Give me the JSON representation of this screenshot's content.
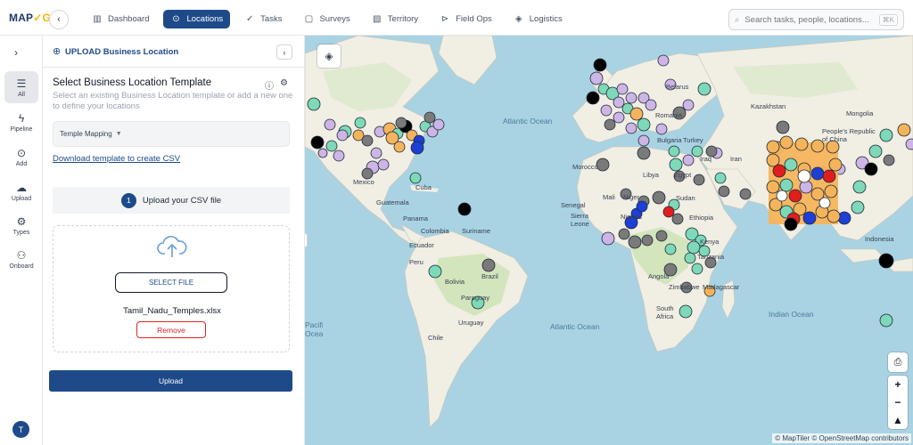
{
  "app": {
    "logo_main": "MAP",
    "logo_accent": "✓G"
  },
  "nav": [
    {
      "label": "Dashboard",
      "icon": "bar-chart-icon",
      "glyph": "▥",
      "active": false
    },
    {
      "label": "Locations",
      "icon": "map-pin-icon",
      "glyph": "⊙",
      "active": true
    },
    {
      "label": "Tasks",
      "icon": "check-list-icon",
      "glyph": "✓",
      "active": false
    },
    {
      "label": "Surveys",
      "icon": "clipboard-icon",
      "glyph": "▢",
      "active": false
    },
    {
      "label": "Territory",
      "icon": "map-icon",
      "glyph": "▧",
      "active": false
    },
    {
      "label": "Field Ops",
      "icon": "signal-icon",
      "glyph": "⊳",
      "active": false
    },
    {
      "label": "Logistics",
      "icon": "box-icon",
      "glyph": "◈",
      "active": false
    }
  ],
  "search": {
    "placeholder": "Search tasks, people, locations...",
    "shortcut": "⌘K"
  },
  "rail": [
    {
      "label": "All",
      "glyph": "☰",
      "active": true
    },
    {
      "label": "Pipeline",
      "glyph": "ϟ",
      "active": false
    },
    {
      "label": "Add",
      "glyph": "⊙",
      "active": false
    },
    {
      "label": "Upload",
      "glyph": "☁",
      "active": false
    },
    {
      "label": "Types",
      "glyph": "⚙",
      "active": false
    },
    {
      "label": "Onboard",
      "glyph": "⚇",
      "active": false
    }
  ],
  "user": {
    "initial": "T"
  },
  "panel": {
    "header_title": "UPLOAD Business Location",
    "template_title": "Select Business Location Template",
    "template_desc": "Select an existing Business Location template or add a new one to define your locations",
    "selected_template": "Temple Mapping",
    "download_link": "Download template to create CSV",
    "step_number": "1",
    "step_label": "Upload your CSV file",
    "select_file_label": "SELECT FILE",
    "file_name": "Tamil_Nadu_Temples.xlsx",
    "remove_label": "Remove",
    "upload_label": "Upload"
  },
  "map": {
    "attribution": "© MapTiler © OpenStreetMap contributors",
    "oceans": [
      "Atlantic Ocean",
      "Atlantic Ocean",
      "Indian Ocean",
      "Pacific Ocean"
    ],
    "places": [
      "Belarus",
      "Kazakhstan",
      "Mongolia",
      "Romania",
      "Bulgaria",
      "Turkey",
      "People's Republic of China",
      "Iraq",
      "Iran",
      "Morocco",
      "Libya",
      "Egypt",
      "Mali",
      "Niger",
      "Sudan",
      "Senegal",
      "Sierra Leone",
      "Nigeria",
      "Ethiopia",
      "Kenya",
      "Tanzania",
      "Angola",
      "Zimbabwe",
      "Madagascar",
      "South Africa",
      "Mexico",
      "Cuba",
      "Guatemala",
      "Panama",
      "Colombia",
      "Ecuador",
      "Suriname",
      "Peru",
      "Brazil",
      "Bolivia",
      "Paraguay",
      "Chile",
      "Uruguay",
      "Indonesia"
    ],
    "marker_colors": {
      "lavender": "#cdb5e6",
      "teal": "#7dd9b8",
      "orange": "#f5b45b",
      "gray": "#7a7a7a",
      "blue": "#1d3fd6",
      "red": "#e01e1e",
      "black": "#000000"
    }
  }
}
